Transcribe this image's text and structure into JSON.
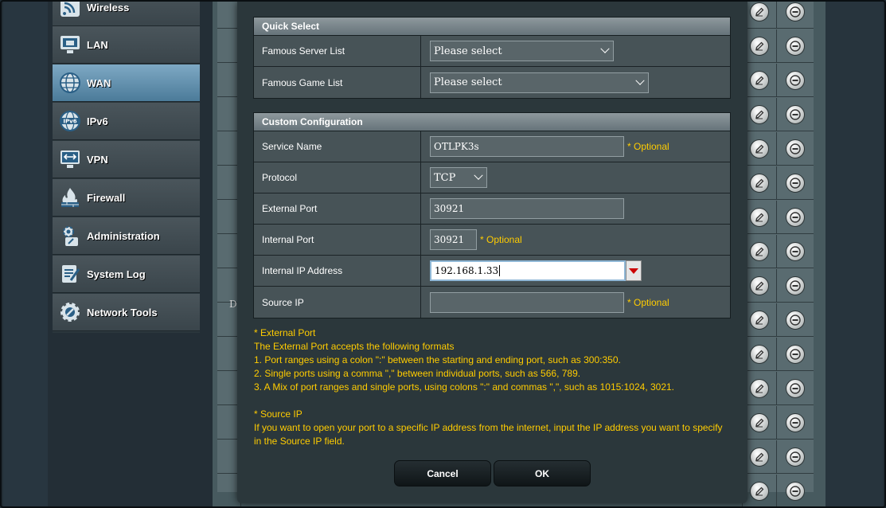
{
  "sidebar": {
    "items": [
      {
        "label": "Wireless",
        "icon": "wireless-icon"
      },
      {
        "label": "LAN",
        "icon": "lan-icon"
      },
      {
        "label": "WAN",
        "icon": "wan-globe-icon",
        "active": true
      },
      {
        "label": "IPv6",
        "icon": "ipv6-icon"
      },
      {
        "label": "VPN",
        "icon": "vpn-icon"
      },
      {
        "label": "Firewall",
        "icon": "firewall-icon"
      },
      {
        "label": "Administration",
        "icon": "administration-icon"
      },
      {
        "label": "System Log",
        "icon": "system-log-icon"
      },
      {
        "label": "Network Tools",
        "icon": "network-tools-icon"
      }
    ]
  },
  "background": {
    "partial_text": "D:"
  },
  "quick_select": {
    "title": "Quick Select",
    "famous_server_label": "Famous Server List",
    "famous_server_value": "Please select",
    "famous_game_label": "Famous Game List",
    "famous_game_value": "Please select"
  },
  "custom": {
    "title": "Custom Configuration",
    "service_name_label": "Service Name",
    "service_name_value": "OTLPK3s",
    "protocol_label": "Protocol",
    "protocol_value": "TCP",
    "external_port_label": "External Port",
    "external_port_value": "30921",
    "internal_port_label": "Internal Port",
    "internal_port_value": "30921",
    "internal_ip_label": "Internal IP Address",
    "internal_ip_value": "192.168.1.33",
    "source_ip_label": "Source IP",
    "source_ip_value": "",
    "optional_text": "* Optional"
  },
  "help": {
    "ext_title": "* External Port",
    "ext_line1": "The External Port accepts the following formats",
    "ext_line2": "1. Port ranges using a colon \":\" between the starting and ending port, such as 300:350.",
    "ext_line3": "2. Single ports using a comma \",\" between individual ports, such as 566, 789.",
    "ext_line4": "3. A Mix of port ranges and single ports, using colons \":\" and commas \",\", such as 1015:1024, 3021.",
    "src_title": "* Source IP",
    "src_line1": "If you want to open your port to a specific IP address from the internet, input the IP address you want to specify",
    "src_line2": "in the Source IP field."
  },
  "buttons": {
    "cancel": "Cancel",
    "ok": "OK"
  },
  "colors": {
    "accent_optional": "#ffcc00",
    "active_nav": "#6e9cb8"
  }
}
